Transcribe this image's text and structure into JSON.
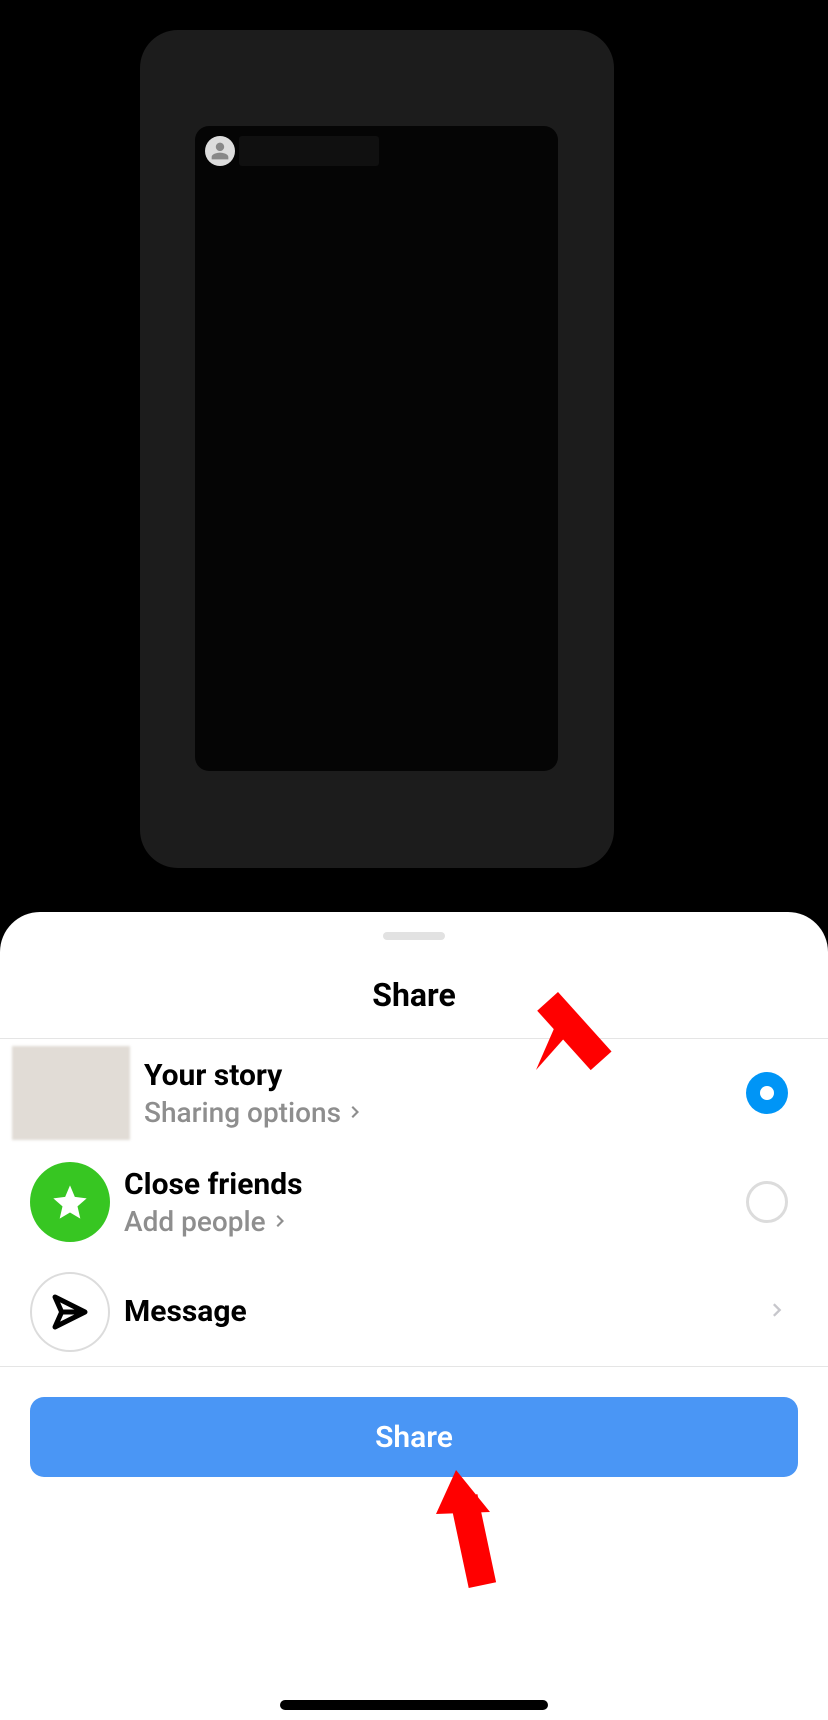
{
  "sheet": {
    "title": "Share",
    "rows": {
      "your_story": {
        "title": "Your story",
        "sub": "Sharing options",
        "selected": true
      },
      "close_friends": {
        "title": "Close friends",
        "sub": "Add people",
        "selected": false
      },
      "message": {
        "title": "Message"
      }
    },
    "share_button": "Share"
  },
  "arrows": {
    "top": {
      "color": "#ff0000"
    },
    "bottom": {
      "color": "#ff0000"
    }
  }
}
